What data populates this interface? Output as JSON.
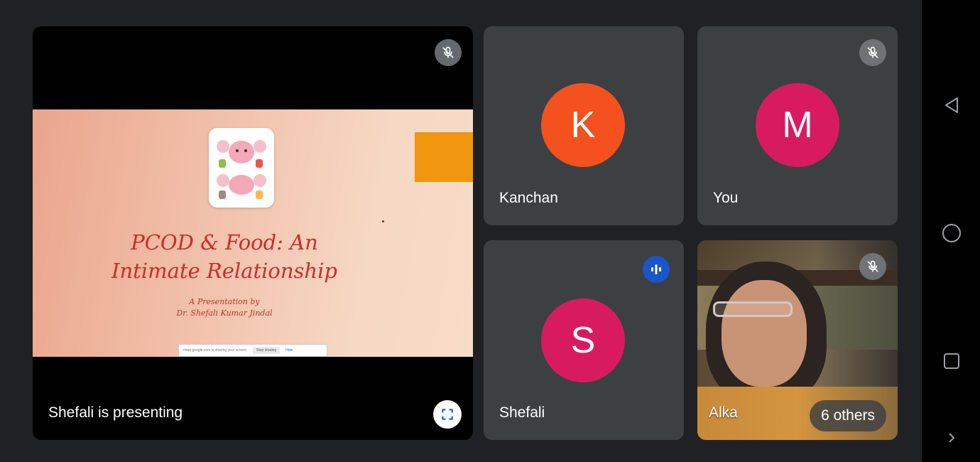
{
  "presentation": {
    "label": "Shefali is presenting",
    "slide": {
      "title_line1": "PCOD & Food: An",
      "title_line2": "Intimate Relationship",
      "byline1": "A Presentation by",
      "byline2": "Dr. Shefali Kumar Jindal",
      "notice_text": "meet.google.com is sharing your screen.",
      "notice_stop": "Stop sharing",
      "notice_hide": "Hide"
    }
  },
  "participants": [
    {
      "name": "Kanchan",
      "initial": "K",
      "color": "#f4511e",
      "muted": false
    },
    {
      "name": "You",
      "initial": "M",
      "color": "#d81b60",
      "muted": true
    },
    {
      "name": "Shefali",
      "initial": "S",
      "color": "#d81b60",
      "speaking": true
    },
    {
      "name": "Alka",
      "muted": true
    }
  ],
  "others": "6 others",
  "colors": {
    "background": "#202124",
    "tile": "#3c4043",
    "speaking": "#1a56c8"
  },
  "nav": [
    "back-icon",
    "home-icon",
    "recents-icon",
    "chevron-right-icon"
  ]
}
